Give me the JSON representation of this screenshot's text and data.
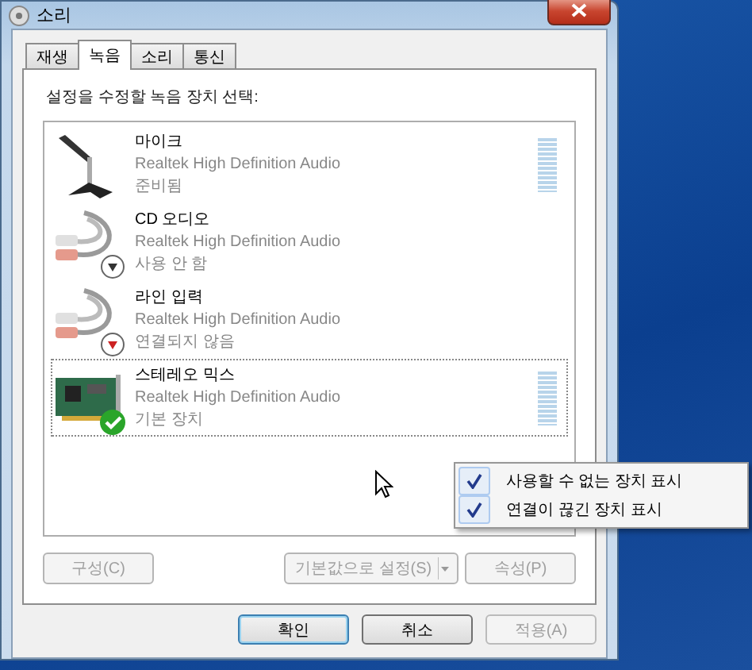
{
  "window": {
    "title": "소리"
  },
  "tabs": [
    {
      "label": "재생",
      "selected": false
    },
    {
      "label": "녹음",
      "selected": true
    },
    {
      "label": "소리",
      "selected": false
    },
    {
      "label": "통신",
      "selected": false
    }
  ],
  "instruction": "설정을 수정할 녹음 장치 선택:",
  "devices": [
    {
      "kind": "microphone",
      "name": "마이크",
      "driver": "Realtek High Definition Audio",
      "status": "준비됨",
      "disabled": false,
      "unplugged": false,
      "default": false,
      "selected": false,
      "level": 0
    },
    {
      "kind": "cable",
      "name": "CD 오디오",
      "driver": "Realtek High Definition Audio",
      "status": "사용 안 함",
      "disabled": true,
      "unplugged": false,
      "default": false,
      "selected": false
    },
    {
      "kind": "cable",
      "name": "라인 입력",
      "driver": "Realtek High Definition Audio",
      "status": "연결되지 않음",
      "disabled": false,
      "unplugged": true,
      "default": false,
      "selected": false
    },
    {
      "kind": "card",
      "name": "스테레오 믹스",
      "driver": "Realtek High Definition Audio",
      "status": "기본 장치",
      "disabled": false,
      "unplugged": false,
      "default": true,
      "selected": true,
      "level": 0
    }
  ],
  "panel_buttons": [
    {
      "kind": "plain",
      "label": "구성(C)",
      "disabled": true
    },
    {
      "kind": "split",
      "label": "기본값으로 설정(S)",
      "disabled": true
    },
    {
      "kind": "plain",
      "label": "속성(P)",
      "disabled": true
    }
  ],
  "dialog_buttons": [
    {
      "label": "확인",
      "default": true,
      "disabled": false
    },
    {
      "label": "취소",
      "default": false,
      "disabled": false
    },
    {
      "label": "적용(A)",
      "default": false,
      "disabled": true
    }
  ],
  "context_menu": [
    {
      "label": "사용할 수 없는 장치 표시",
      "checked": true
    },
    {
      "label": "연결이 끊긴 장치 표시",
      "checked": true
    }
  ]
}
